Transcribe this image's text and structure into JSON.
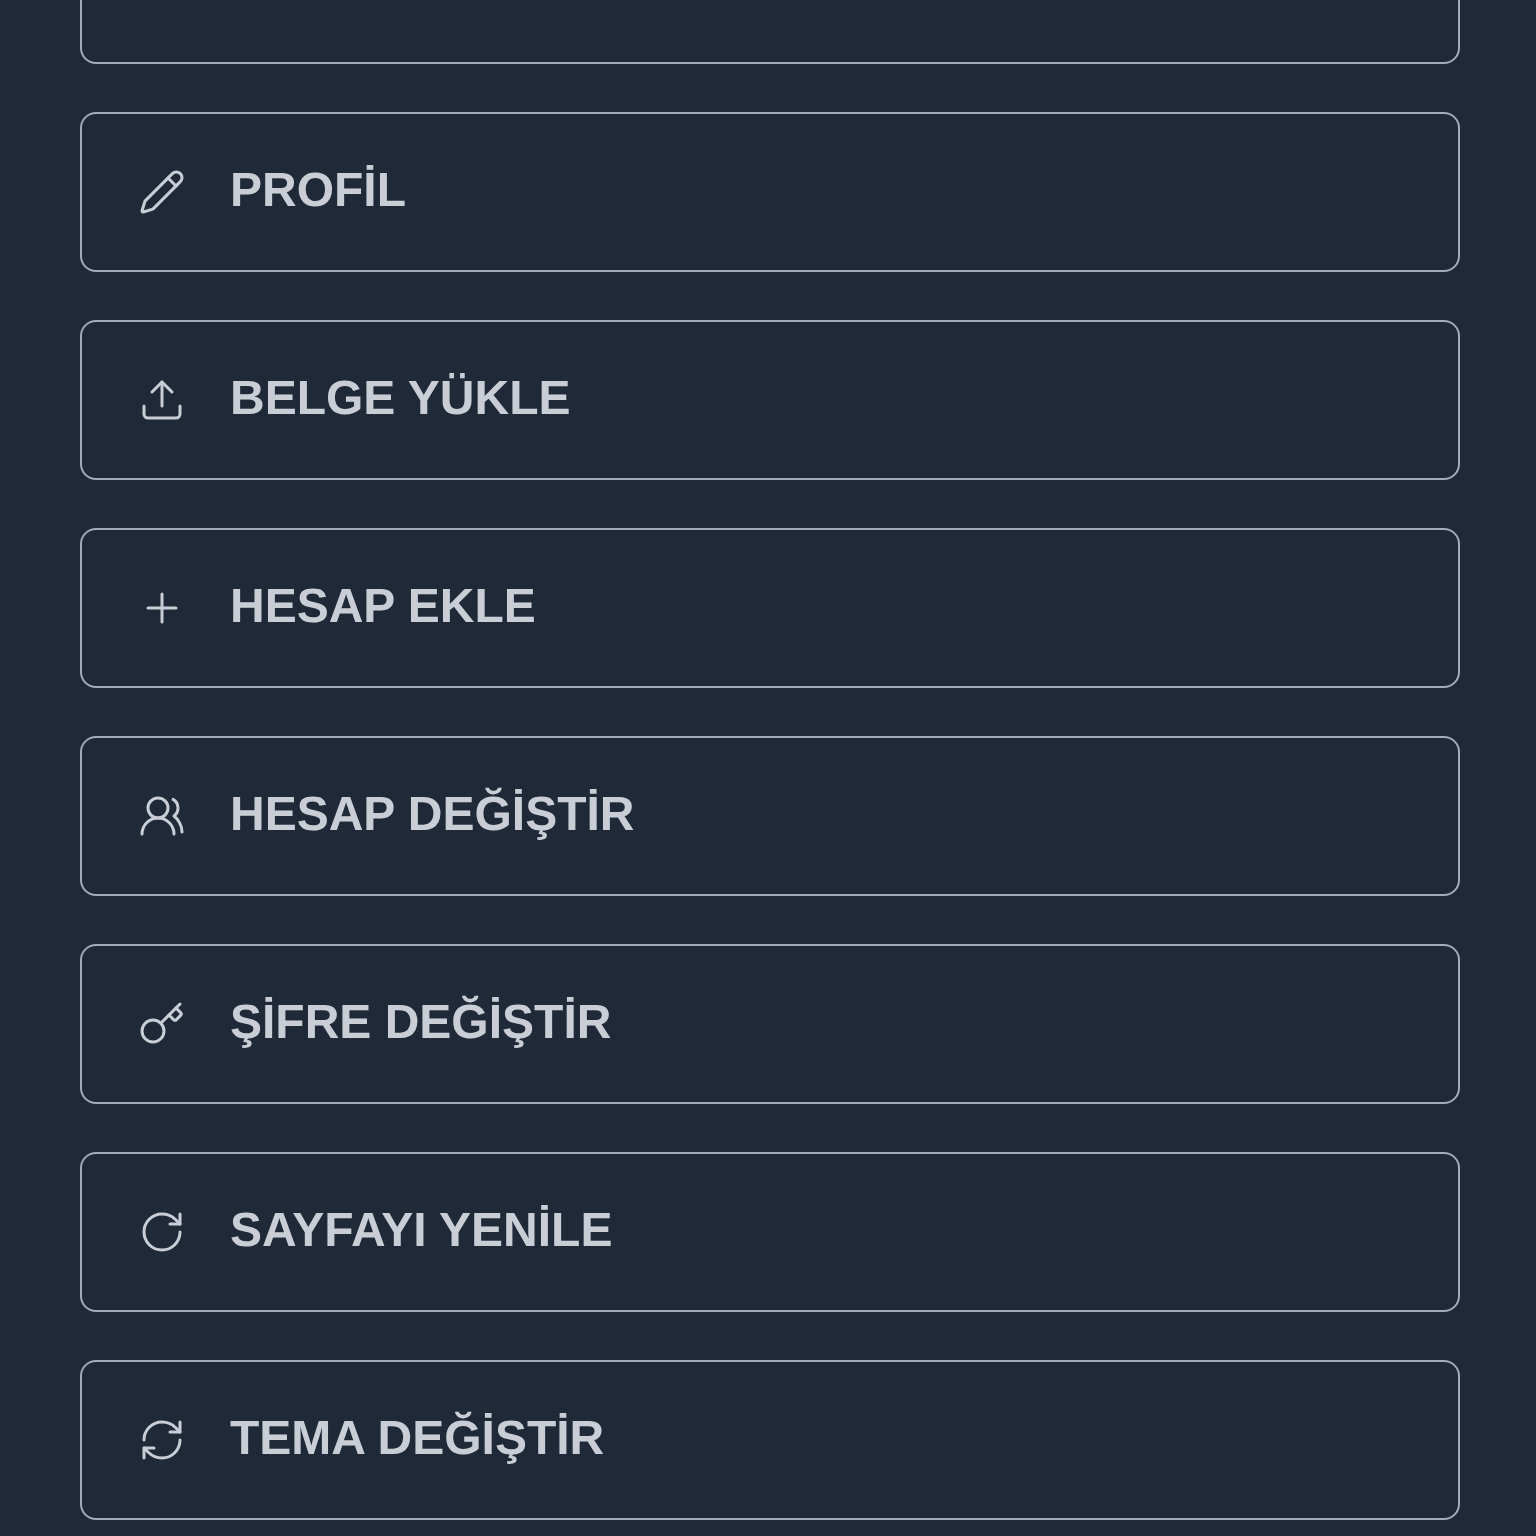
{
  "menu_items": [
    {
      "kind": "partial"
    },
    {
      "kind": "edit",
      "label": "PROFİL"
    },
    {
      "kind": "upload",
      "label": "BELGE YÜKLE"
    },
    {
      "kind": "add",
      "label": "HESAP EKLE"
    },
    {
      "kind": "users",
      "label": "HESAP DEĞİŞTİR"
    },
    {
      "kind": "key",
      "label": "ŞİFRE DEĞİŞTİR"
    },
    {
      "kind": "reload",
      "label": "SAYFAYI YENİLE"
    },
    {
      "kind": "theme",
      "label": "TEMA DEĞİŞTİR"
    }
  ]
}
